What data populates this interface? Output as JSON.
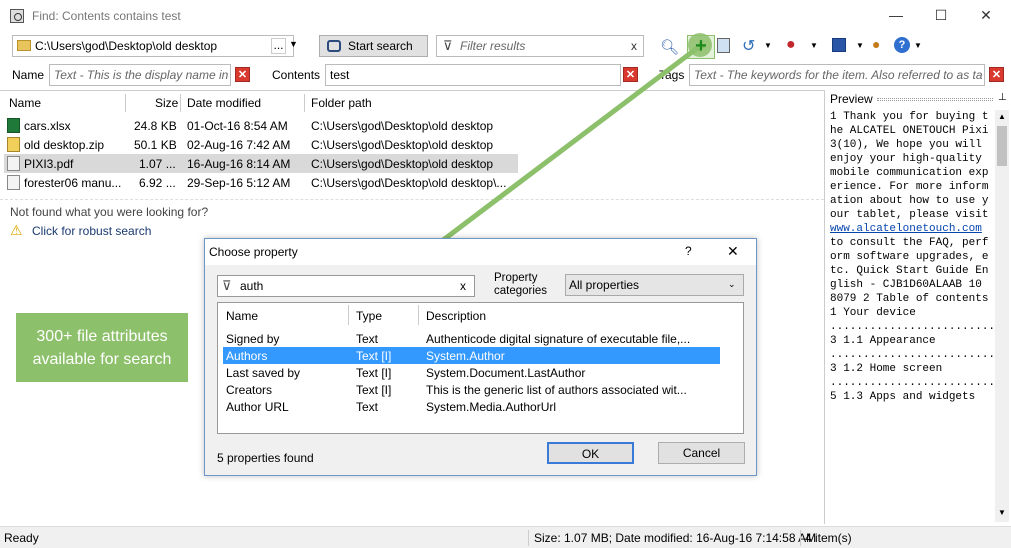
{
  "window": {
    "title": "Find: Contents contains test",
    "minimize": "—",
    "maximize": "☐",
    "close": "✕"
  },
  "search": {
    "location": "C:\\Users\\god\\Desktop\\old desktop",
    "browse": "...",
    "start_label": "Start search",
    "filter_placeholder": "Filter results",
    "name_label": "Name",
    "name_placeholder": "Text - This is the display name in",
    "contents_label": "Contents",
    "contents_value": "test",
    "tags_label": "Tags",
    "tags_placeholder": "Text - The keywords for the item. Also referred to as tags"
  },
  "results": {
    "columns": [
      "Name",
      "Size",
      "Date modified",
      "Folder path"
    ],
    "rows": [
      {
        "name": "cars.xlsx",
        "size": "24.8 KB",
        "date": "01-Oct-16 8:54 AM",
        "path": "C:\\Users\\god\\Desktop\\old desktop",
        "icon": "excel-file-icon"
      },
      {
        "name": "old desktop.zip",
        "size": "50.1 KB",
        "date": "02-Aug-16 7:42 AM",
        "path": "C:\\Users\\god\\Desktop\\old desktop",
        "icon": "zip-file-icon"
      },
      {
        "name": "PIXI3.pdf",
        "size": "1.07 ...",
        "date": "16-Aug-16 8:14 AM",
        "path": "C:\\Users\\god\\Desktop\\old desktop",
        "icon": "pdf-file-icon"
      },
      {
        "name": "forester06 manu...",
        "size": "6.92 ...",
        "date": "29-Sep-16 5:12 AM",
        "path": "C:\\Users\\god\\Desktop\\old desktop\\...",
        "icon": "pdf-file-icon"
      }
    ],
    "not_found": "Not found what you were looking for?",
    "robust_search": "Click for robust search"
  },
  "callout": {
    "text": "300+ file attributes available for search",
    "color": "#8dc06b"
  },
  "dialog": {
    "title": "Choose property",
    "help": "?",
    "close": "✕",
    "search_value": "auth",
    "clear": "x",
    "categories_label": "Property categories",
    "categories_value": "All properties",
    "columns": [
      "Name",
      "Type",
      "Description"
    ],
    "rows": [
      {
        "name": "Signed by",
        "type": "Text",
        "desc": "Authenticode digital signature of executable file,..."
      },
      {
        "name": "Authors",
        "type": "Text [I]",
        "desc": "System.Author"
      },
      {
        "name": "Last saved by",
        "type": "Text [I]",
        "desc": "System.Document.LastAuthor"
      },
      {
        "name": "Creators",
        "type": "Text [I]",
        "desc": "This is the generic list of authors associated wit..."
      },
      {
        "name": "Author URL",
        "type": "Text",
        "desc": "System.Media.AuthorUrl"
      }
    ],
    "count": "5 properties found",
    "ok": "OK",
    "cancel": "Cancel"
  },
  "preview": {
    "title": "Preview",
    "text_before": "1 Thank you for buying the ALCATEL ONETOUCH Pixi3(10), We hope you will enjoy your high-quality mobile communication experience. For more information about how to use your tablet, please visit ",
    "link": "www.alcatelonetouch.com",
    "text_after": " to consult the FAQ, perform software upgrades, etc. Quick Start Guide English - CJB1D60ALAAB 10 8079 2 Table of contents 1 Your device ................................... 3 1.1 Appearance ....................................................3 1.2 Home screen ................................................5 1.3 Apps and widgets"
  },
  "status": {
    "left": "Ready",
    "right": "Size: 1.07 MB; Date modified: 16-Aug-16 7:14:58 AM",
    "count": "4 item(s)"
  },
  "colors": {
    "selection": "#3399ff",
    "row_highlight": "#d9d9d9",
    "arrow": "#8dc06b"
  }
}
